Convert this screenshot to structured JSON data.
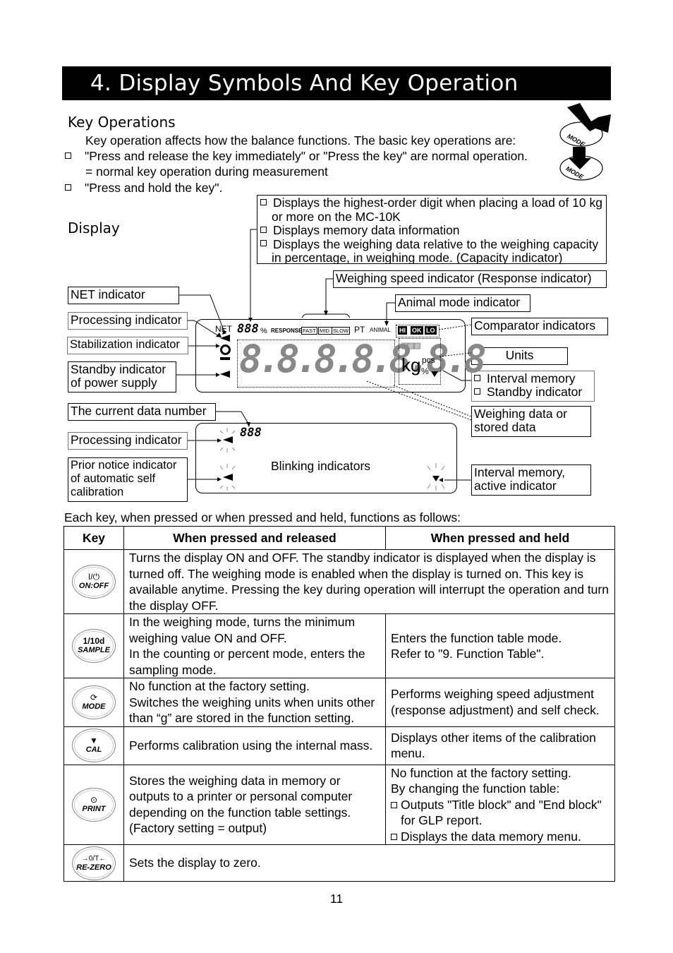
{
  "title": "4.   Display Symbols And Key Operation",
  "key_operations": {
    "heading": "Key Operations",
    "intro": "Key operation affects how the balance functions. The basic key operations are:",
    "bullets": [
      "\"Press and release the key immediately\" or \"Press the key\" are normal operation.",
      "\"Press and hold the key\"."
    ],
    "bullet1_sub": "= normal key operation during measurement",
    "illustration_key_label": "MODE"
  },
  "display": {
    "heading": "Display",
    "top_callout": {
      "items": [
        "Displays the highest-order digit when placing a load of 10 kg",
        "Displays memory data information",
        "Displays the weighing data relative to the weighing capacity"
      ],
      "item1_cont": "or more on the MC-10K",
      "item3_cont": "in percentage, in weighing mode. (Capacity indicator)"
    },
    "labels": {
      "response": "Weighing speed indicator (Response indicator)",
      "animal": "Animal mode indicator",
      "net": "NET indicator",
      "processing": "Processing indicator",
      "stabilization": "Stabilization indicator",
      "standby_1": "Standby indicator",
      "standby_2": "of power supply",
      "comparator": "Comparator indicators",
      "units": "Units",
      "interval_memory": "Interval memory",
      "standby_indicator": "Standby indicator",
      "weighing_data_1": "Weighing data or",
      "weighing_data_2": "stored data",
      "current_data_number": "The current data number",
      "processing2": "Processing indicator",
      "prior_notice_1": "Prior notice indicator",
      "prior_notice_2": "of automatic self",
      "prior_notice_3": "calibration",
      "interval_active_1": "Interval memory,",
      "interval_active_2": "active indicator",
      "blinking": "Blinking indicators"
    },
    "lcd": {
      "net": "NET",
      "small_digits": "888",
      "percent": "%",
      "response": "RESPONSE",
      "fast": "FAST",
      "mid": "MID.",
      "slow": "SLOW",
      "pt": "PT",
      "animal": "ANIMAL",
      "hi": "HI",
      "ok": "OK",
      "lo": "LO",
      "main_digits": "8.8.8.8.8.8.8",
      "kg": "kg",
      "pcs": "pcs",
      "pct": "%"
    },
    "lcd2": {
      "digits": "888"
    }
  },
  "table": {
    "intro": "Each key, when pressed or when pressed and held, functions as follows:",
    "headers": [
      "Key",
      "When pressed and released",
      "When pressed and held"
    ],
    "rows": [
      {
        "key_symbol": "I/⏻",
        "key_label": "ON:OFF",
        "released": "Turns the display ON and OFF. The standby indicator is displayed when the display is turned off. The weighing mode is enabled when the display is turned on. This key is available anytime. Pressing the key during operation will interrupt the operation and turn the display OFF.",
        "held": ""
      },
      {
        "key_symbol": "1/10d",
        "key_label": "SAMPLE",
        "released_lines": [
          "In the weighing mode, turns the minimum weighing value ON and OFF.",
          "In the counting or percent mode, enters the sampling mode."
        ],
        "held_lines": [
          "Enters the function table mode.",
          "Refer to \"9. Function Table\"."
        ]
      },
      {
        "key_symbol": "⟳",
        "key_label": "MODE",
        "released_lines": [
          "No function at the factory setting.",
          "Switches the weighing units when units other than “g” are stored in the function setting."
        ],
        "held": "Performs weighing speed adjustment (response adjustment) and self check."
      },
      {
        "key_symbol": "▼",
        "key_label": "CAL",
        "released": "Performs calibration using the internal mass.",
        "held": "Displays other items of the calibration menu."
      },
      {
        "key_symbol": "⊙",
        "key_label": "PRINT",
        "released_lines": [
          "Stores the weighing data in memory or outputs to a printer or personal computer depending on the function table settings.",
          "(Factory setting = output)"
        ],
        "held_intro": [
          "No function at the factory setting.",
          "By changing the function table:"
        ],
        "held_bullets": [
          "Outputs \"Title block\" and \"End block\" for GLP report.",
          "Displays the data memory menu."
        ]
      },
      {
        "key_symbol": "→0/T←",
        "key_label": "RE-ZERO",
        "released": "Sets the display to zero.",
        "held": ""
      }
    ]
  },
  "page_number": "11"
}
